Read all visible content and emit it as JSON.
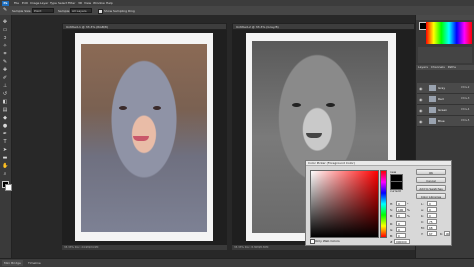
{
  "app": {
    "logo": "Ps"
  },
  "menu": [
    "File",
    "Edit",
    "Image",
    "Layer",
    "Type",
    "Select",
    "Filter",
    "3D",
    "View",
    "Window",
    "Help"
  ],
  "options": {
    "sample_size_label": "Sample Size:",
    "sample_size_value": "Point Sample",
    "sample_label": "Sample:",
    "sample_value": "All Layers",
    "show_ring_label": "Show Sampling Ring"
  },
  "documents": [
    {
      "tab": "Untitled-1 @ 33.3% (RGB/8)",
      "status": "33.33%   Doc: 24.9M/24.9M"
    },
    {
      "tab": "Untitled-2 @ 33.3% (Gray/8)",
      "status": "33.33%   Doc: 8.30M/8.30M"
    }
  ],
  "layers_panel": {
    "tabs": [
      "Layers",
      "Channels",
      "Paths"
    ],
    "rows": [
      {
        "name": "Gray",
        "tag": "Ctrl+2"
      },
      {
        "name": "Red",
        "tag": "Ctrl+3"
      },
      {
        "name": "Green",
        "tag": "Ctrl+4"
      },
      {
        "name": "Blue",
        "tag": "Ctrl+5"
      }
    ]
  },
  "color_picker": {
    "title": "Color Picker (Foreground Color)",
    "new_label": "new",
    "current_label": "current",
    "ok": "OK",
    "cancel": "Cancel",
    "add_swatches": "Add to Swatches",
    "color_libraries": "Color Libraries",
    "only_web": "Only Web Colors",
    "fields": [
      {
        "label": "H:",
        "value": "0",
        "unit": "°"
      },
      {
        "label": "S:",
        "value": "100",
        "unit": "%"
      },
      {
        "label": "B:",
        "value": "0",
        "unit": "%"
      },
      {
        "label": "R:",
        "value": "0",
        "unit": ""
      },
      {
        "label": "G:",
        "value": "0",
        "unit": ""
      },
      {
        "label": "B:",
        "value": "0",
        "unit": ""
      }
    ],
    "lab_fields": [
      {
        "label": "L:",
        "value": "0"
      },
      {
        "label": "a:",
        "value": "0"
      },
      {
        "label": "b:",
        "value": "0"
      },
      {
        "label": "C:",
        "value": "75"
      },
      {
        "label": "M:",
        "value": "68"
      },
      {
        "label": "Y:",
        "value": "67"
      },
      {
        "label": "K:",
        "value": "90"
      }
    ],
    "hex_label": "#",
    "hex": "000000",
    "new_color": "#000000",
    "current_color": "#000000"
  },
  "bottom_tabs": [
    "Mini Bridge",
    "Timeline"
  ],
  "colors": {
    "accent": "#1e6fbf"
  }
}
